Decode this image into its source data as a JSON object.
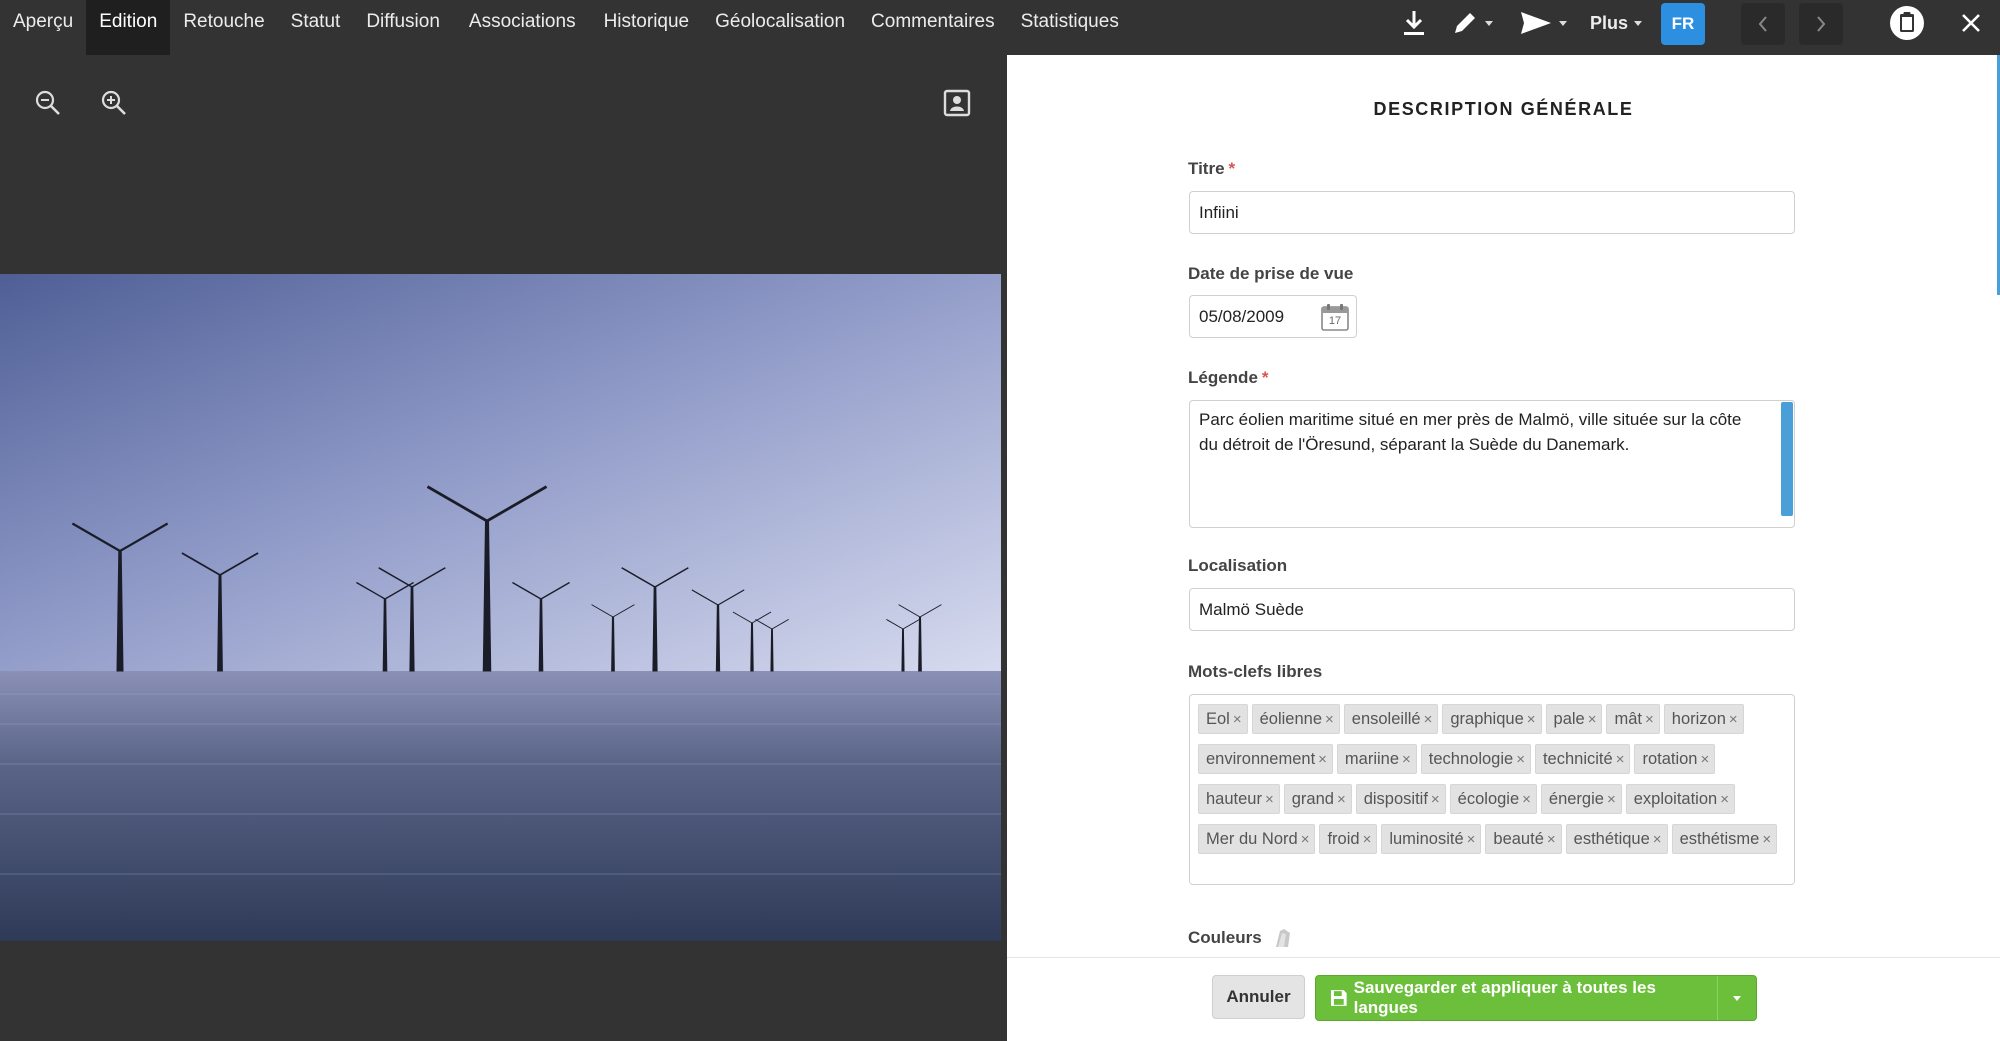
{
  "nav": {
    "items": [
      "Aperçu",
      "Edition",
      "Retouche",
      "Statut",
      "Diffusion",
      "Associations",
      "Historique",
      "Géolocalisation",
      "Commentaires",
      "Statistiques"
    ],
    "active_index": 1
  },
  "toolbar": {
    "download_icon": "download-icon",
    "edit_icon": "pencil-icon",
    "send_icon": "send-icon",
    "plus_label": "Plus",
    "lang": "FR"
  },
  "viewer": {
    "zoom_out_icon": "zoom-out-icon",
    "zoom_in_icon": "zoom-in-icon",
    "portrait_icon": "portrait-icon"
  },
  "form": {
    "section_title": "DESCRIPTION GÉNÉRALE",
    "title_label": "Titre",
    "title_value": "Infiini",
    "date_label": "Date de prise de vue",
    "date_value": "05/08/2009",
    "date_icon_day": "17",
    "caption_label": "Légende",
    "caption_value": "Parc éolien maritime situé en mer près de Malmö, ville située sur la côte du détroit de l'Öresund, séparant la Suède du Danemark.",
    "location_label": "Localisation",
    "location_value": "Malmö Suède",
    "keywords_label": "Mots-clefs libres",
    "keywords": [
      "Eol",
      "éolienne",
      "ensoleillé",
      "graphique",
      "pale",
      "mât",
      "horizon",
      "environnement",
      "mariine",
      "technologie",
      "technicité",
      "rotation",
      "hauteur",
      "grand",
      "dispositif",
      "écologie",
      "énergie",
      "exploitation",
      "Mer du Nord",
      "froid",
      "luminosité",
      "beauté",
      "esthétique",
      "esthétisme"
    ],
    "colors_label": "Couleurs",
    "required_mark": "*"
  },
  "footer": {
    "cancel_label": "Annuler",
    "save_label": "Sauvegarder et appliquer à toutes les langues"
  },
  "colors": {
    "accent_blue": "#2d8fe0",
    "save_green": "#6cbf3a",
    "required_red": "#d9534f"
  }
}
